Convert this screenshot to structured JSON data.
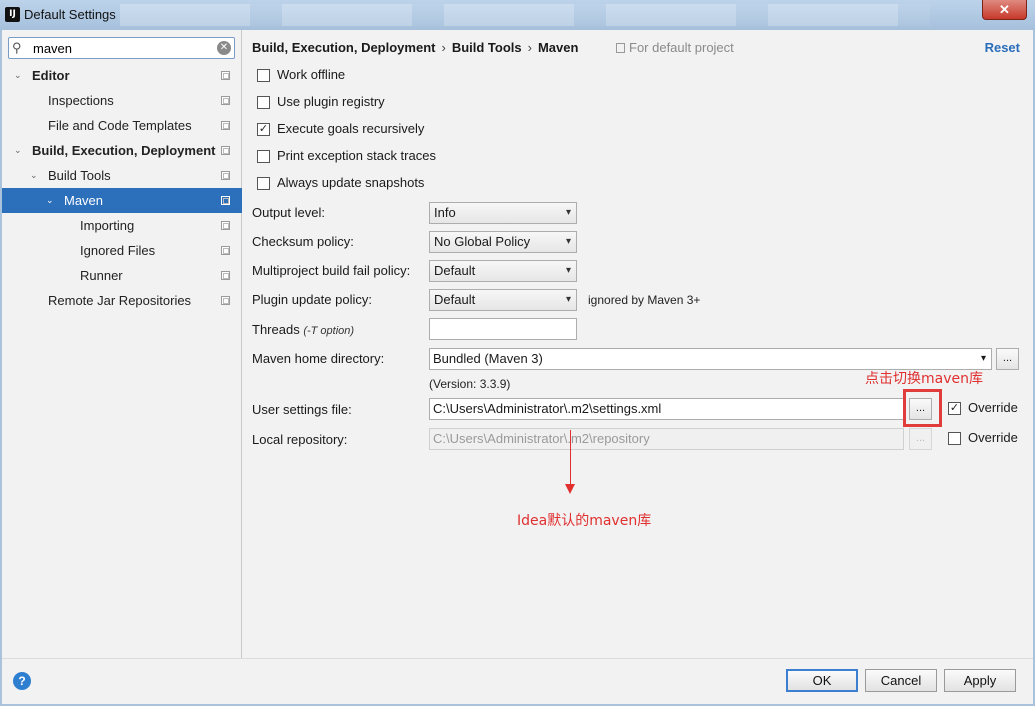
{
  "window": {
    "title": "Default Settings",
    "app_icon_text": "IJ",
    "close_label": "✕"
  },
  "search": {
    "value": "maven",
    "placeholder": ""
  },
  "sidebar": {
    "items": [
      {
        "label": "Editor",
        "arrow": "⌄"
      },
      {
        "label": "Inspections"
      },
      {
        "label": "File and Code Templates"
      },
      {
        "label": "Build, Execution, Deployment",
        "arrow": "⌄"
      },
      {
        "label": "Build Tools",
        "arrow": "⌄"
      },
      {
        "label": "Maven",
        "arrow": "⌄"
      },
      {
        "label": "Importing"
      },
      {
        "label": "Ignored Files"
      },
      {
        "label": "Runner"
      },
      {
        "label": "Remote Jar Repositories"
      }
    ]
  },
  "breadcrumb": {
    "items": [
      "Build, Execution, Deployment",
      "Build Tools",
      "Maven"
    ],
    "separator": "›"
  },
  "scope_label": "For default project",
  "reset_label": "Reset",
  "checkboxes": [
    {
      "label": "Work offline",
      "checked": false
    },
    {
      "label": "Use plugin registry",
      "checked": false
    },
    {
      "label": "Execute goals recursively",
      "checked": true
    },
    {
      "label": "Print exception stack traces",
      "checked": false
    },
    {
      "label": "Always update snapshots",
      "checked": false
    }
  ],
  "form": {
    "output_level": {
      "label": "Output level:",
      "value": "Info"
    },
    "checksum_policy": {
      "label": "Checksum policy:",
      "value": "No Global Policy"
    },
    "fail_policy": {
      "label": "Multiproject build fail policy:",
      "value": "Default"
    },
    "plugin_update_policy": {
      "label": "Plugin update policy:",
      "value": "Default",
      "note": "ignored by Maven 3+"
    },
    "threads": {
      "label": "Threads",
      "hint": "(-T option)",
      "value": ""
    },
    "maven_home": {
      "label": "Maven home directory:",
      "value": "Bundled (Maven 3)",
      "version": "(Version: 3.3.9)"
    },
    "user_settings": {
      "label": "User settings file:",
      "value": "C:\\Users\\Administrator\\.m2\\settings.xml",
      "override_label": "Override",
      "override_checked": true
    },
    "local_repository": {
      "label": "Local repository:",
      "value": "C:\\Users\\Administrator\\.m2\\repository",
      "override_label": "Override",
      "override_checked": false
    },
    "browse_label": "...",
    "caret": "▾"
  },
  "annotations": {
    "switch_repo": "点击切换maven库",
    "default_repo": "Idea默认的maven库",
    "color": "#e03030"
  },
  "footer": {
    "help_label": "?",
    "ok_label": "OK",
    "cancel_label": "Cancel",
    "apply_label": "Apply"
  },
  "colors": {
    "selection": "#2c6fbb",
    "link": "#2a6ebb",
    "annotation": "#e03030"
  }
}
